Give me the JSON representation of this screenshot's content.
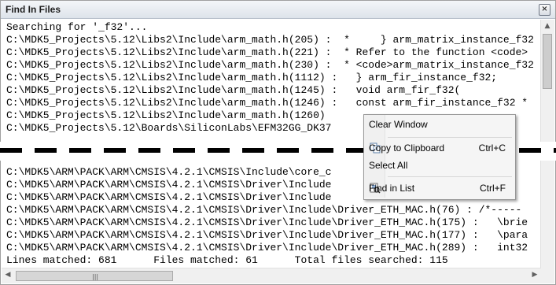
{
  "window": {
    "title": "Find In Files",
    "close_glyph": "×"
  },
  "output_top": [
    "Searching for '_f32'...",
    "C:\\MDK5_Projects\\5.12\\Libs2\\Include\\arm_math.h(205) :  *     } arm_matrix_instance_f32",
    "C:\\MDK5_Projects\\5.12\\Libs2\\Include\\arm_math.h(221) :  * Refer to the function <code>",
    "C:\\MDK5_Projects\\5.12\\Libs2\\Include\\arm_math.h(230) :  * <code>arm_matrix_instance_f32",
    "C:\\MDK5_Projects\\5.12\\Libs2\\Include\\arm_math.h(1112) :   } arm_fir_instance_f32;",
    "C:\\MDK5_Projects\\5.12\\Libs2\\Include\\arm_math.h(1245) :   void arm_fir_f32(",
    "C:\\MDK5_Projects\\5.12\\Libs2\\Include\\arm_math.h(1246) :   const arm_fir_instance_f32 *",
    "C:\\MDK5_Projects\\5.12\\Libs2\\Include\\arm_math.h(1260)",
    "C:\\MDK5_Projects\\5.12\\Boards\\SiliconLabs\\EFM32GG_DK37                                  ient"
  ],
  "output_bottom": [
    "C:\\MDK5\\ARM\\PACK\\ARM\\CMSIS\\4.2.1\\CMSIS\\Include\\core_c                                  uint",
    "C:\\MDK5\\ARM\\PACK\\ARM\\CMSIS\\4.2.1\\CMSIS\\Driver\\Include                                  Conf",
    "C:\\MDK5\\ARM\\PACK\\ARM\\CMSIS\\4.2.1\\CMSIS\\Driver\\Include                                  ine",
    "C:\\MDK5\\ARM\\PACK\\ARM\\CMSIS\\4.2.1\\CMSIS\\Driver\\Include\\Driver_ETH_MAC.h(76) : /*-----",
    "C:\\MDK5\\ARM\\PACK\\ARM\\CMSIS\\4.2.1\\CMSIS\\Driver\\Include\\Driver_ETH_MAC.h(175) :   \\brie",
    "C:\\MDK5\\ARM\\PACK\\ARM\\CMSIS\\4.2.1\\CMSIS\\Driver\\Include\\Driver_ETH_MAC.h(177) :   \\para",
    "C:\\MDK5\\ARM\\PACK\\ARM\\CMSIS\\4.2.1\\CMSIS\\Driver\\Include\\Driver_ETH_MAC.h(289) :   int32"
  ],
  "summary": "Lines matched: 681      Files matched: 61      Total files searched: 115",
  "context_menu": {
    "clear_window": "Clear Window",
    "copy": "Copy to Clipboard",
    "copy_shortcut": "Ctrl+C",
    "select_all": "Select All",
    "find_in_list": "Find in List",
    "find_shortcut": "Ctrl+F"
  },
  "scrollbar": {
    "up": "▲",
    "left": "◀",
    "right": "▶",
    "grip": "|||"
  },
  "icons": {
    "copy": "copy-icon",
    "find": "find-in-list-icon"
  }
}
